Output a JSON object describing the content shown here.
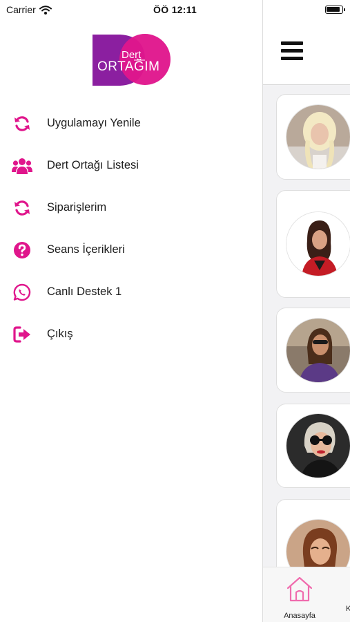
{
  "status_bar": {
    "carrier": "Carrier",
    "time": "ÖÖ 12:11"
  },
  "brand": {
    "logo_text_line1": "Dert",
    "logo_text_line2": "ORTAĞIM",
    "colors": {
      "primary": "#e0168c",
      "secondary": "#8b1fa0"
    }
  },
  "drawer": {
    "items": [
      {
        "label": "Uygulamayı Yenile",
        "icon": "refresh-icon"
      },
      {
        "label": "Dert Ortağı Listesi",
        "icon": "users-icon"
      },
      {
        "label": "Siparişlerim",
        "icon": "refresh-icon"
      },
      {
        "label": "Seans İçerikleri",
        "icon": "question-circle-icon"
      },
      {
        "label": "Canlı Destek 1",
        "icon": "whatsapp-icon"
      },
      {
        "label": "Çıkış",
        "icon": "logout-icon"
      }
    ]
  },
  "main": {
    "header_icon": "hamburger-menu-icon",
    "tabs": [
      {
        "label": "Anasayfa",
        "icon": "home-icon"
      },
      {
        "label": "K"
      }
    ]
  }
}
